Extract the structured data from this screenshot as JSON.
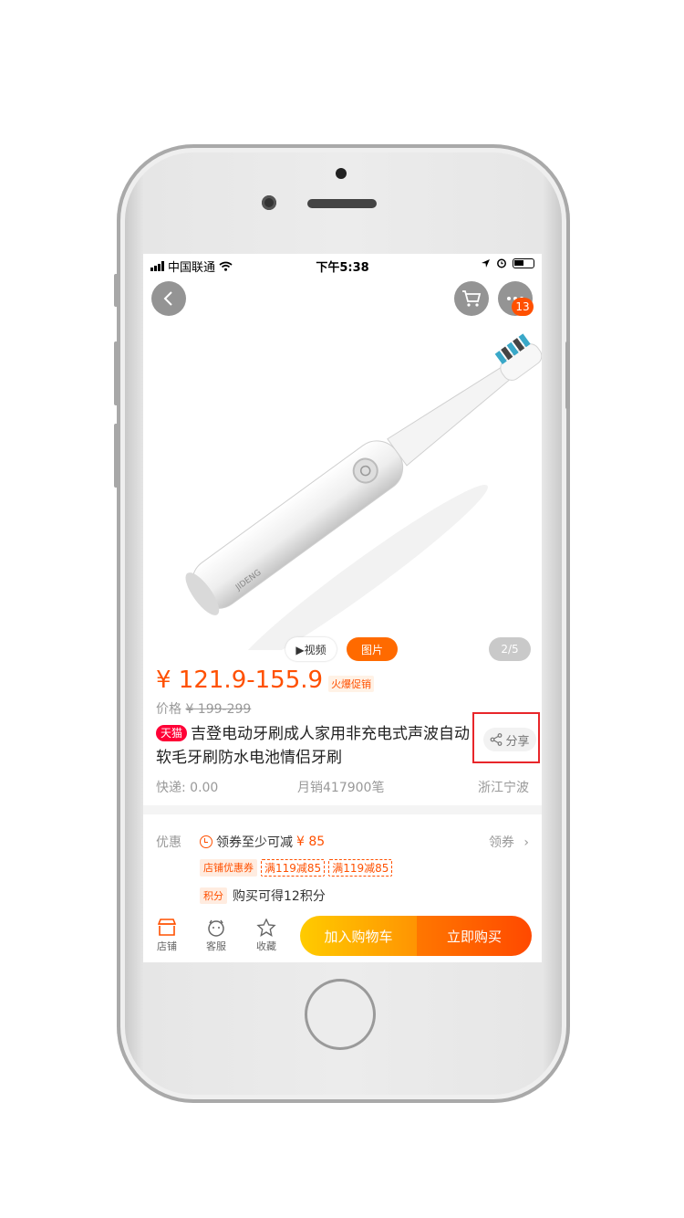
{
  "status_bar": {
    "carrier": "中国联通",
    "time": "下午5:38"
  },
  "header": {
    "more_badge": "13"
  },
  "gallery": {
    "video_label": "▶视频",
    "image_label": "图片",
    "index": "2/5",
    "product_logo_text": "JIDENG"
  },
  "price": {
    "range": "¥ 121.9-155.9",
    "promo_tag": "火爆促销",
    "original_label": "价格",
    "original_value": "¥ 199-299"
  },
  "title": {
    "store_tag": "天猫",
    "text": "吉登电动牙刷成人家用非充电式声波自动软毛牙刷防水电池情侣牙刷"
  },
  "share_label": "分享",
  "meta": {
    "shipping": "快递: 0.00",
    "monthly_sales": "月销417900笔",
    "location": "浙江宁波"
  },
  "promotions": {
    "label": "优惠",
    "coupon_text": "领券至少可减",
    "coupon_amount": "¥ 85",
    "get_coupon": "领券",
    "tags": [
      "店铺优惠券",
      "满119减85",
      "满119减85"
    ],
    "points_tag": "积分",
    "points_text": "购买可得12积分"
  },
  "bottom_bar": {
    "store": "店铺",
    "service": "客服",
    "favorite": "收藏",
    "add_to_cart": "加入购物车",
    "buy_now": "立即购买"
  },
  "colors": {
    "accent": "#ff5000",
    "tmall": "#ff0036",
    "cart_start": "#ffcb00",
    "buy_end": "#ff4900",
    "highlight_box": "#e8262a"
  }
}
